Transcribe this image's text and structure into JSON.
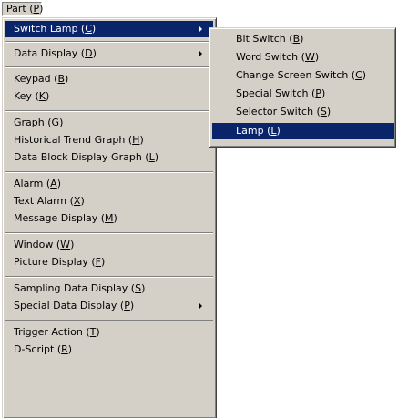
{
  "menubar": {
    "label": "Part (P)"
  },
  "main_menu": {
    "items": [
      {
        "label": "Switch Lamp (C)",
        "highlighted": true,
        "submenu": true
      },
      {
        "label": "Data Display (D)",
        "submenu": true
      },
      {
        "label": "Keypad (B)"
      },
      {
        "label": "Key (K)"
      },
      {
        "label": "Graph (G)"
      },
      {
        "label": "Historical Trend Graph (H)"
      },
      {
        "label": "Data Block Display Graph (L)"
      },
      {
        "label": "Alarm (A)"
      },
      {
        "label": "Text Alarm (X)"
      },
      {
        "label": "Message Display (M)"
      },
      {
        "label": "Window (W)"
      },
      {
        "label": "Picture Display (F)"
      },
      {
        "label": "Sampling Data Display (S)"
      },
      {
        "label": "Special Data Display (P)",
        "submenu": true
      },
      {
        "label": "Trigger Action (T)"
      },
      {
        "label": "D-Script (R)"
      }
    ]
  },
  "submenu": {
    "items": [
      {
        "label": "Bit Switch (B)"
      },
      {
        "label": "Word Switch (W)"
      },
      {
        "label": "Change Screen Switch (C)"
      },
      {
        "label": "Special Switch (P)"
      },
      {
        "label": "Selector Switch (S)"
      },
      {
        "label": "Lamp (L)",
        "highlighted": true
      }
    ]
  },
  "colors": {
    "menu_bg": "#d4d0c8",
    "highlight": "#0a246a",
    "highlight_text": "#ffffff"
  }
}
